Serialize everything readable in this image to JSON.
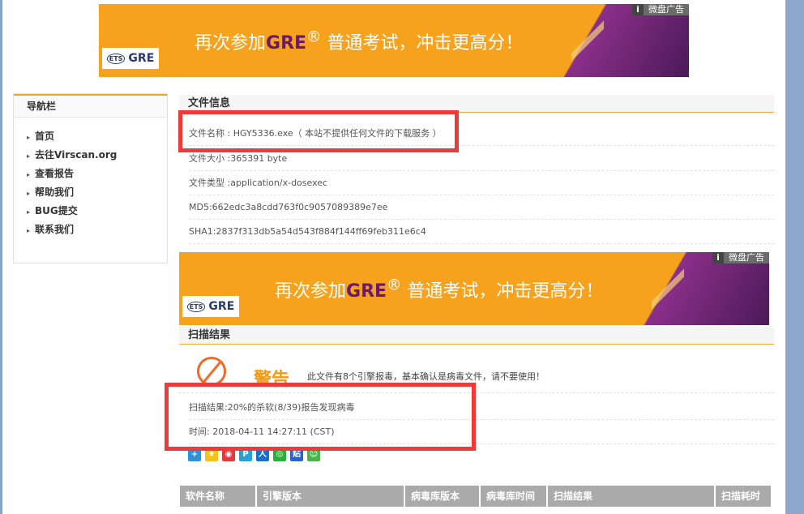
{
  "ads": {
    "label": "微盘广告",
    "info": "i",
    "text_pre": "再次参加",
    "text_brand": "GRE",
    "text_reg": "®",
    "text_post": " 普通考试，冲击更高分！",
    "logo_ets": "ETS",
    "logo_gre": "GRE"
  },
  "nav": {
    "title": "导航栏",
    "items": [
      "首页",
      "去往Virscan.org",
      "查看报告",
      "帮助我们",
      "BUG提交",
      "联系我们"
    ]
  },
  "file_info": {
    "title": "文件信息",
    "name": "文件名称 : HGY5336.exe（ 本站不提供任何文件的下载服务 ）",
    "size": "文件大小 :365391 byte",
    "type": "文件类型 :application/x-dosexec",
    "md5": "MD5:662edc3a8cdd763f0c9057089389e7ee",
    "sha1": "SHA1:2837f313db5a54d543f884f144ff69feb311e6c4"
  },
  "scan": {
    "title": "扫描结果",
    "warn_title": "警告",
    "warn_desc": "此文件有8个引擎报毒，基本确认是病毒文件，请不要使用！",
    "result": "扫描结果:20%的杀软(8/39)报告发现病毒",
    "time": "时间: 2018-04-11 14:27:11 (CST)"
  },
  "share_icons": [
    "plus-icon",
    "qzone-icon",
    "weibo-icon",
    "pengyou-icon",
    "renren-icon",
    "wechat-icon",
    "tieba-icon",
    "kaixin-icon"
  ],
  "table": {
    "headers": [
      "软件名称",
      "引擎版本",
      "病毒库版本",
      "病毒库时间",
      "扫描结果",
      "扫描耗时"
    ]
  },
  "colors": {
    "accent": "#f1a83c",
    "warn": "#f39a1a",
    "highlight_box": "#ee3a3a"
  }
}
